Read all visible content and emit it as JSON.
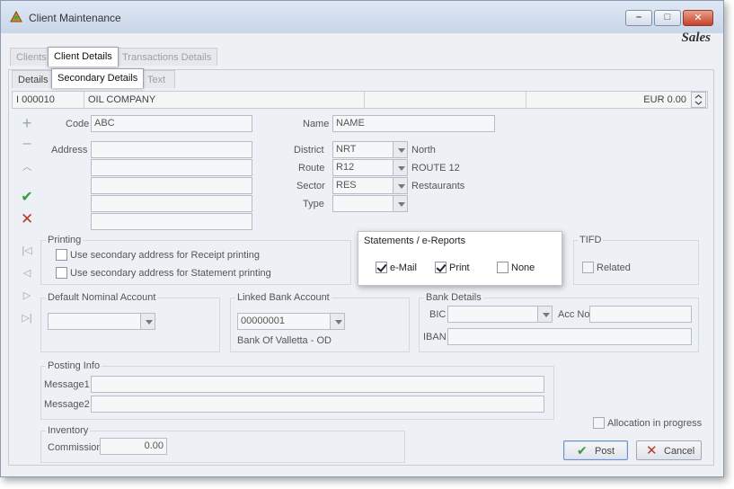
{
  "window": {
    "title": "Client Maintenance",
    "brand": "Sales"
  },
  "tabs_main": [
    {
      "label": "Clients"
    },
    {
      "label": "Client Details"
    },
    {
      "label": "Transactions Details"
    }
  ],
  "tabs_sub": [
    {
      "label": "Details"
    },
    {
      "label": "Secondary Details"
    },
    {
      "label": "Text"
    }
  ],
  "record_bar": {
    "marker": "I",
    "code": "000010",
    "name": "OIL COMPANY",
    "balance": "EUR 0.00"
  },
  "form": {
    "code_label": "Code",
    "code_value": "ABC",
    "address_label": "Address",
    "name_label": "Name",
    "name_value": "NAME",
    "district_label": "District",
    "district_value": "NRT",
    "district_desc": "North",
    "route_label": "Route",
    "route_value": "R12",
    "route_desc": "ROUTE 12",
    "sector_label": "Sector",
    "sector_value": "RES",
    "sector_desc": "Restaurants",
    "type_label": "Type",
    "type_value": ""
  },
  "printing": {
    "title": "Printing",
    "receipt_label": "Use secondary address for Receipt printing",
    "receipt_checked": false,
    "statement_label": "Use secondary address for Statement printing",
    "statement_checked": false
  },
  "statements": {
    "title": "Statements / e-Reports",
    "email_label": "e-Mail",
    "email_checked": true,
    "print_label": "Print",
    "print_checked": true,
    "none_label": "None",
    "none_checked": false
  },
  "tifd": {
    "title": "TIFD",
    "related_label": "Related",
    "related_checked": false
  },
  "nominal": {
    "title": "Default Nominal Account",
    "value": ""
  },
  "bank": {
    "title": "Linked Bank Account",
    "value": "00000001",
    "desc": "Bank Of Valletta - OD"
  },
  "bank_details": {
    "title": "Bank Details",
    "bic_label": "BIC",
    "accno_label": "Acc No",
    "iban_label": "IBAN"
  },
  "posting": {
    "title": "Posting Info",
    "msg1_label": "Message1",
    "msg2_label": "Message2"
  },
  "inventory": {
    "title": "Inventory",
    "commission_label": "Commission",
    "commission_value": "0.00"
  },
  "allocation_label": "Allocation in progress",
  "buttons": {
    "post": "Post",
    "cancel": "Cancel"
  },
  "colors": {
    "accent_check": "#3a9a3a",
    "delete_x": "#b53a2a"
  }
}
